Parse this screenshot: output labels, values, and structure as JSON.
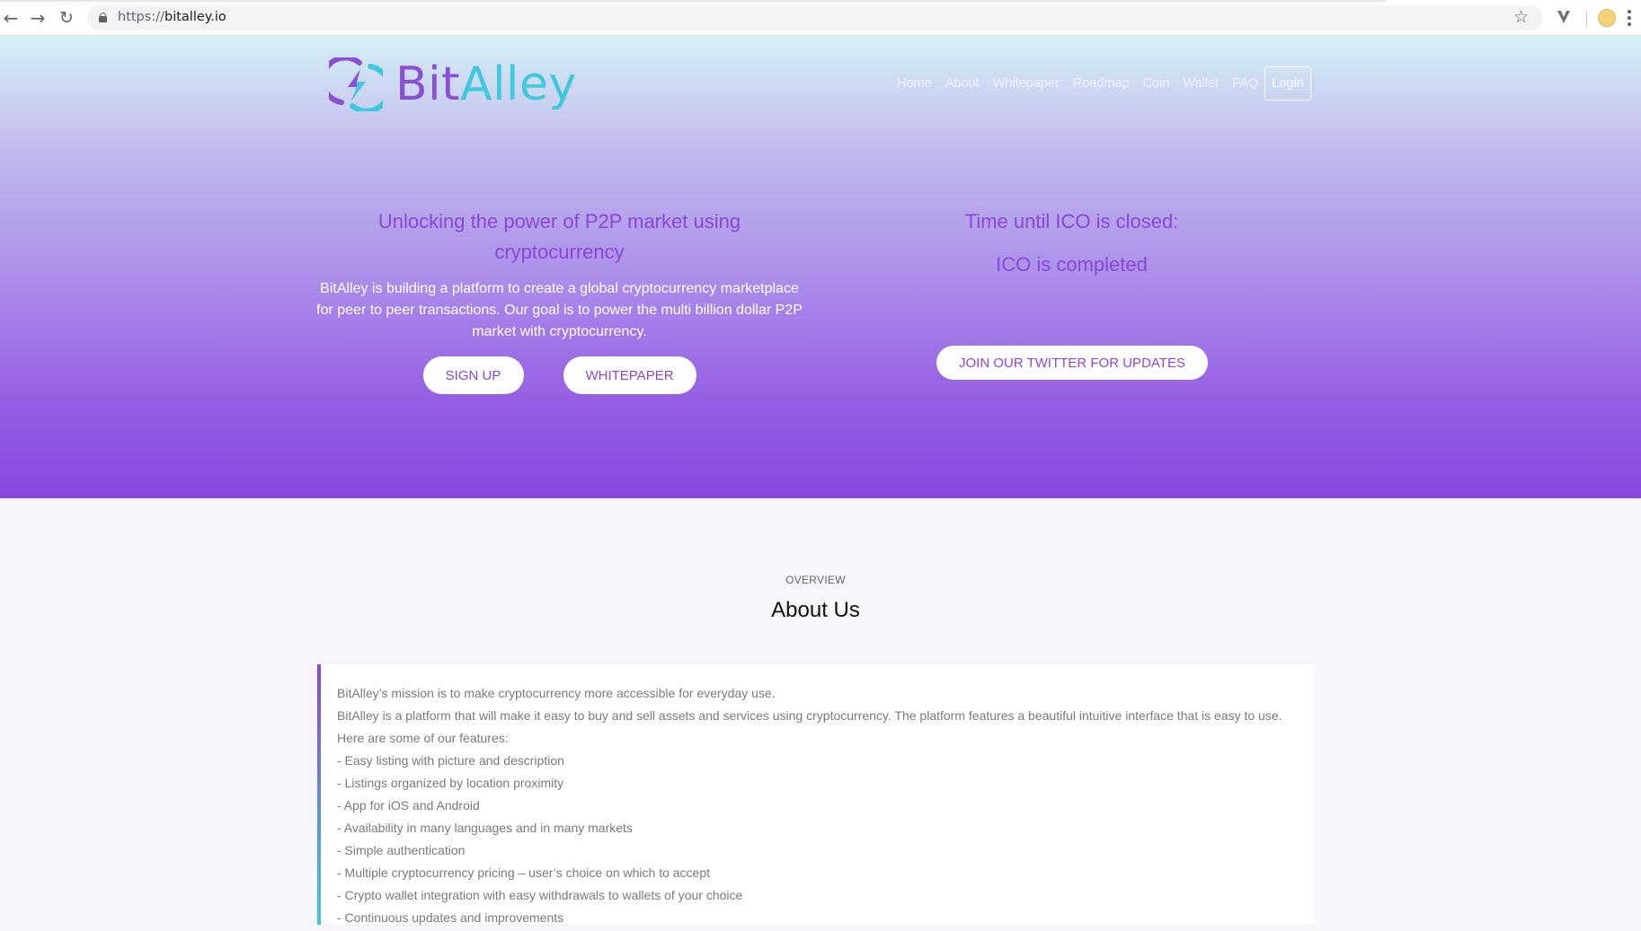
{
  "browser": {
    "url_scheme": "https://",
    "url_host": "bitalley.io",
    "back_icon": "back-arrow-icon",
    "forward_icon": "forward-arrow-icon",
    "reload_icon": "reload-icon",
    "star_icon": "star-icon",
    "menu_icon": "more-vert-icon"
  },
  "logo": {
    "part1": "Bit",
    "part2": "Alley",
    "colors": {
      "bit": "#8a4fd6",
      "alley": "#3ec9de"
    }
  },
  "nav": {
    "items": [
      "Home",
      "About",
      "Whitepaper",
      "Roadmap",
      "Coin",
      "Wallet",
      "FAQ"
    ],
    "login": "Login"
  },
  "hero": {
    "title": "Unlocking the power of P2P market using cryptocurrency",
    "description": "BitAlley is building a platform to create a global cryptocurrency marketplace for peer to peer transactions. Our goal is to power the multi billion dollar P2P market with cryptocurrency.",
    "signup_label": "SIGN UP",
    "whitepaper_label": "WHITEPAPER",
    "ico_title": "Time until ICO is closed:",
    "ico_status": "ICO is completed",
    "twitter_label": "JOIN OUR TWITTER FOR UPDATES",
    "accent_color": "#8a46d8"
  },
  "about": {
    "eyebrow": "OVERVIEW",
    "title": "About Us",
    "lines": [
      "BitAlley’s mission is to make cryptocurrency more accessible for everyday use.",
      "BitAlley is a platform that will make it easy to buy and sell assets and services using cryptocurrency. The platform features a beautiful intuitive interface that is easy to use.",
      "Here are some of our features:",
      "- Easy listing with picture and description",
      "- Listings organized by location proximity",
      "- App for iOS and Android",
      "- Availability in many languages and in many markets",
      "- Simple authentication",
      "- Multiple cryptocurrency pricing – user’s choice on which to accept",
      "- Crypto wallet integration with easy withdrawals to wallets of your choice",
      "- Continuous updates and improvements"
    ]
  }
}
